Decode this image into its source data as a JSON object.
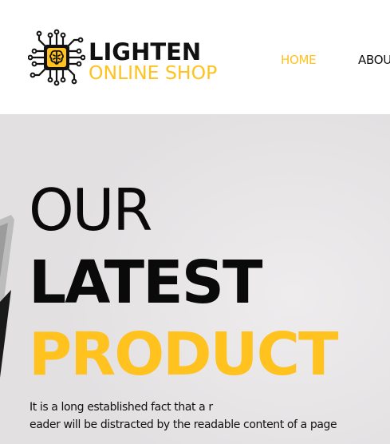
{
  "header": {
    "logo": {
      "title": "LIGHTEN",
      "subtitle": "ONLINE SHOP",
      "icon": "circuit-brain-icon"
    },
    "nav": {
      "items": [
        {
          "label": "HOME",
          "active": true
        },
        {
          "label": "ABOUT",
          "active": false
        }
      ]
    }
  },
  "hero": {
    "line1": "OUR",
    "line2": "LATEST",
    "line3": "PRODUCT",
    "description": [
      "It is a long established fact that a r",
      "eader will be distracted by the readable content of a page"
    ]
  },
  "colors": {
    "accent": "#ffc21f",
    "text": "#111111",
    "hero_background": "#e2e0e1"
  }
}
